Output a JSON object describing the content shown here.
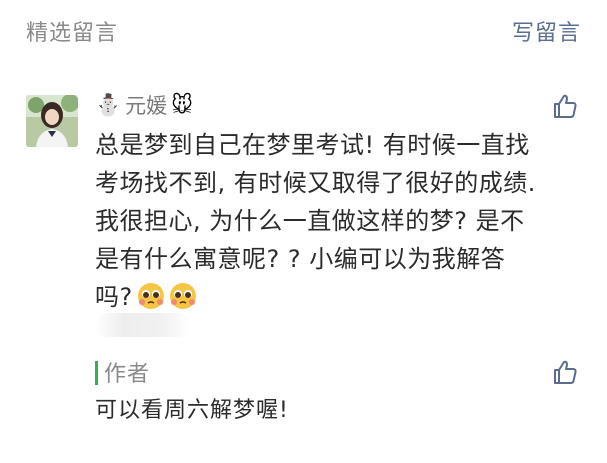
{
  "header": {
    "title": "精选留言",
    "write": "写留言"
  },
  "comment": {
    "username": "元媛",
    "snowman_icon": "⛄",
    "mouse_icon": "🐭",
    "text_lines": [
      "总是梦到自己在梦里考试! 有时候一直找",
      "考场找不到, 有时候又取得了很好的成绩.",
      "我很担心, 为什么一直做这样的梦? 是不",
      "是有什么寓意呢? ? 小编可以为我解答",
      "吗?"
    ],
    "emoji_icons": [
      "pleading-face-icon",
      "pleading-face-icon"
    ]
  },
  "reply": {
    "label": "作者",
    "text": "可以看周六解梦喔!"
  },
  "colors": {
    "accent": "#35b34a",
    "link": "#5a6d8f",
    "muted": "#8a8a8a"
  }
}
